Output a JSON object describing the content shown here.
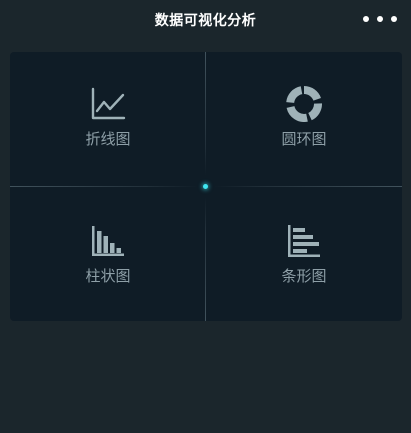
{
  "header": {
    "title": "数据可视化分析",
    "more_icon": "more-dots-icon"
  },
  "grid": {
    "items": [
      {
        "label": "折线图",
        "icon": "line-chart-icon"
      },
      {
        "label": "圆环图",
        "icon": "donut-chart-icon"
      },
      {
        "label": "柱状图",
        "icon": "bar-chart-icon"
      },
      {
        "label": "条形图",
        "icon": "horizontal-bar-chart-icon"
      }
    ]
  },
  "colors": {
    "background": "#1b262c",
    "panel": "#0f1c26",
    "icon": "#9fb2b8",
    "label": "#8e9fa7",
    "accent_dot": "#3fe6f0",
    "title": "#ffffff"
  }
}
